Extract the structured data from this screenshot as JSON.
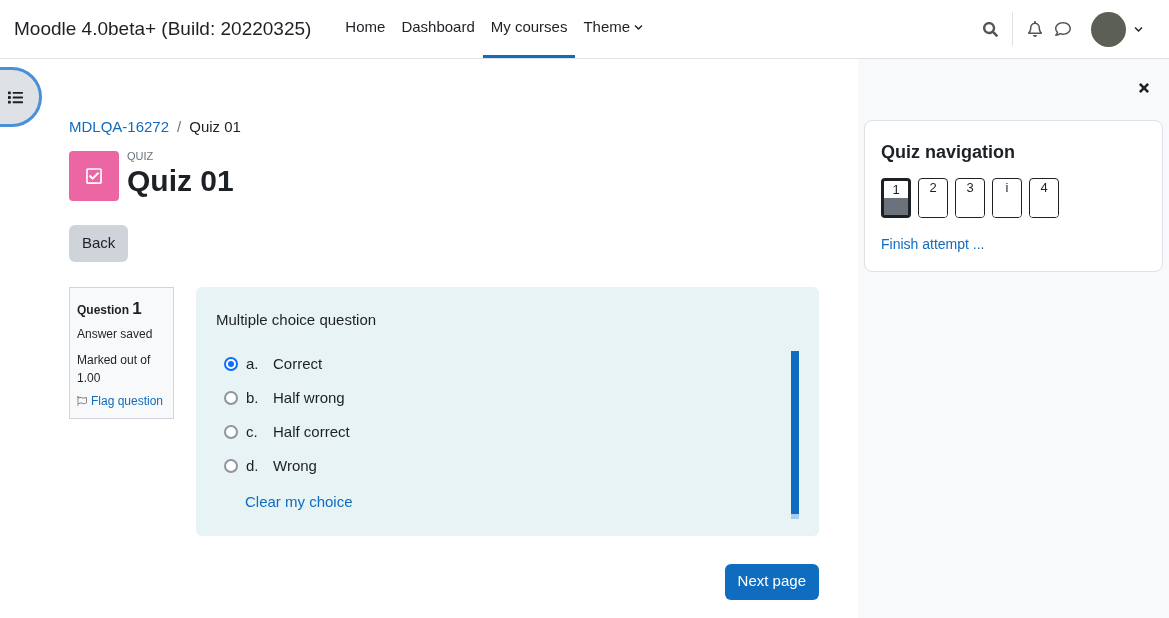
{
  "navbar": {
    "site_name": "Moodle 4.0beta+ (Build: 20220325)",
    "links": [
      {
        "label": "Home",
        "selected": false,
        "dropdown": false
      },
      {
        "label": "Dashboard",
        "selected": false,
        "dropdown": false
      },
      {
        "label": "My courses",
        "selected": true,
        "dropdown": false
      },
      {
        "label": "Theme",
        "selected": false,
        "dropdown": true
      }
    ]
  },
  "breadcrumb": [
    {
      "label": "MDLQA-16272",
      "kind": "link"
    },
    {
      "label": "/",
      "kind": "separator"
    },
    {
      "label": "Quiz 01",
      "kind": "text"
    }
  ],
  "activity": {
    "type_label": "QUIZ",
    "title": "Quiz 01"
  },
  "back_button": "Back",
  "question_info": {
    "label": "Question",
    "number": "1",
    "status": "Answer saved",
    "mark": "Marked out of 1.00",
    "flag": "Flag question"
  },
  "question": {
    "prompt": "Multiple choice question",
    "options": [
      {
        "letter": "a.",
        "text": "Correct",
        "selected": true
      },
      {
        "letter": "b.",
        "text": "Half wrong",
        "selected": false
      },
      {
        "letter": "c.",
        "text": "Half correct",
        "selected": false
      },
      {
        "letter": "d.",
        "text": "Wrong",
        "selected": false
      }
    ],
    "clear": "Clear my choice"
  },
  "next_button": "Next page",
  "quiz_navigation": {
    "title": "Quiz navigation",
    "buttons": [
      {
        "label": "1",
        "current": true,
        "answered": true
      },
      {
        "label": "2",
        "current": false,
        "answered": false
      },
      {
        "label": "3",
        "current": false,
        "answered": false
      },
      {
        "label": "i",
        "current": false,
        "answered": false
      },
      {
        "label": "4",
        "current": false,
        "answered": false
      }
    ],
    "finish": "Finish attempt ..."
  }
}
